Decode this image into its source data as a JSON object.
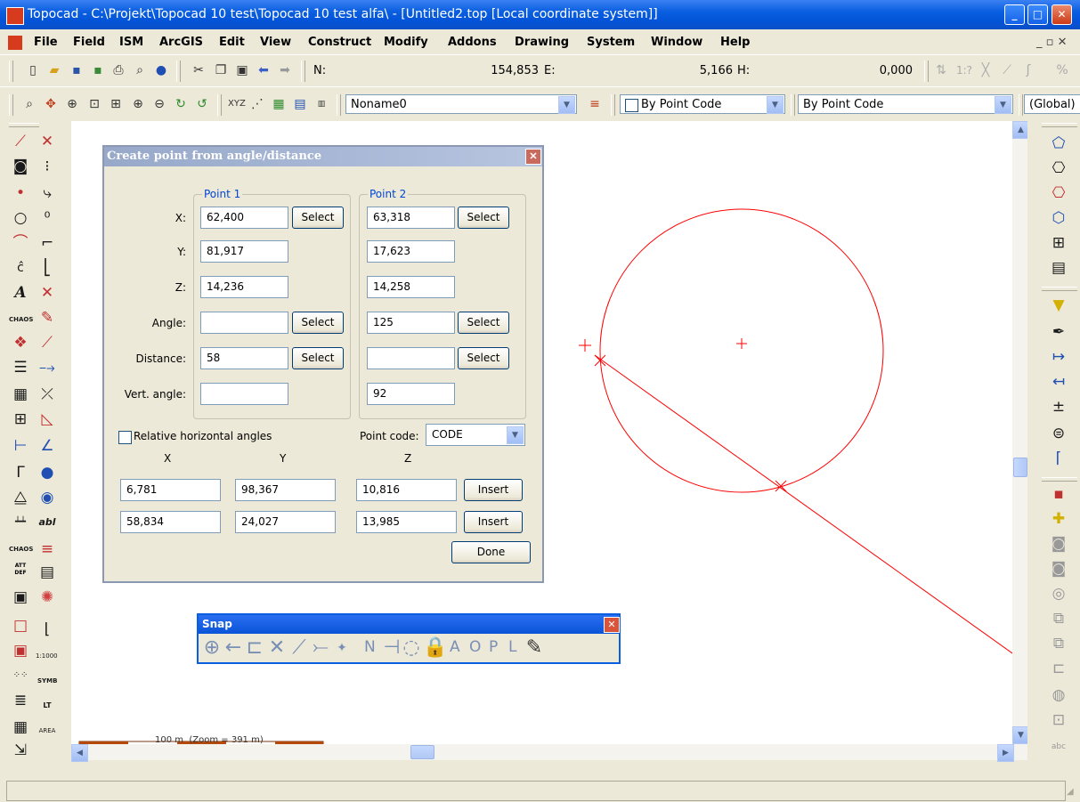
{
  "window": {
    "title": "Topocad - C:\\Projekt\\Topocad 10 test\\Topocad 10 test alfa\\ - [Untitled2.top [Local coordinate system]]",
    "min_label": "_",
    "max_label": "□",
    "close_label": "✕"
  },
  "menu": {
    "items": [
      "File",
      "Field",
      "ISM",
      "ArcGIS",
      "Edit",
      "View",
      "Construct",
      "Modify",
      "Addons",
      "Drawing",
      "System",
      "Window",
      "Help"
    ],
    "right_controls": "_ ▫ ✕"
  },
  "coordbar": {
    "n_label": "N:",
    "n_value": "154,853",
    "e_label": "E:",
    "e_value": "5,166",
    "h_label": "H:",
    "h_value": "0,000",
    "scale_text": "1:?"
  },
  "layerbar": {
    "layer_value": "Noname0",
    "color_value": "By Point Code",
    "linetype_value": "By Point Code",
    "global_value": "(Global)"
  },
  "dialog": {
    "title": "Create point from angle/distance",
    "point1_label": "Point 1",
    "point2_label": "Point 2",
    "row_labels": [
      "X:",
      "Y:",
      "Z:",
      "Angle:",
      "Distance:",
      "Vert. angle:"
    ],
    "point1": {
      "x": "62,400",
      "y": "81,917",
      "z": "14,236",
      "angle": "",
      "distance": "58",
      "vert_angle": ""
    },
    "point2": {
      "x": "63,318",
      "y": "17,623",
      "z": "14,258",
      "angle": "125",
      "distance": "",
      "vert_angle": "92"
    },
    "select_label": "Select",
    "relative_label": "Relative horizontal angles",
    "relative_checked": false,
    "point_code_label": "Point code:",
    "point_code_value": "CODE",
    "col_x": "X",
    "col_y": "Y",
    "col_z": "Z",
    "results": [
      {
        "x": "6,781",
        "y": "98,367",
        "z": "10,816"
      },
      {
        "x": "58,834",
        "y": "24,027",
        "z": "13,985"
      }
    ],
    "insert_label": "Insert",
    "done_label": "Done"
  },
  "snap": {
    "title": "Snap",
    "letters": [
      "N",
      "A",
      "O",
      "P",
      "L"
    ]
  },
  "scalebar": {
    "text": "100 m  (Zoom = 391 m)"
  },
  "left_toolbar_text": {
    "chaos1": "CHAOS",
    "att": "ATT",
    "def": "DEF",
    "scale": "1:1000",
    "symb": "SYMB",
    "lt": "LT",
    "area": "AREA",
    "abl": "abl"
  },
  "colors": {
    "title_bar": "#0a5ee0",
    "canvas": "#ffffff",
    "drawing": "#ff0000",
    "dialog_bg": "#ece9d8",
    "group_label": "#0046d5"
  }
}
